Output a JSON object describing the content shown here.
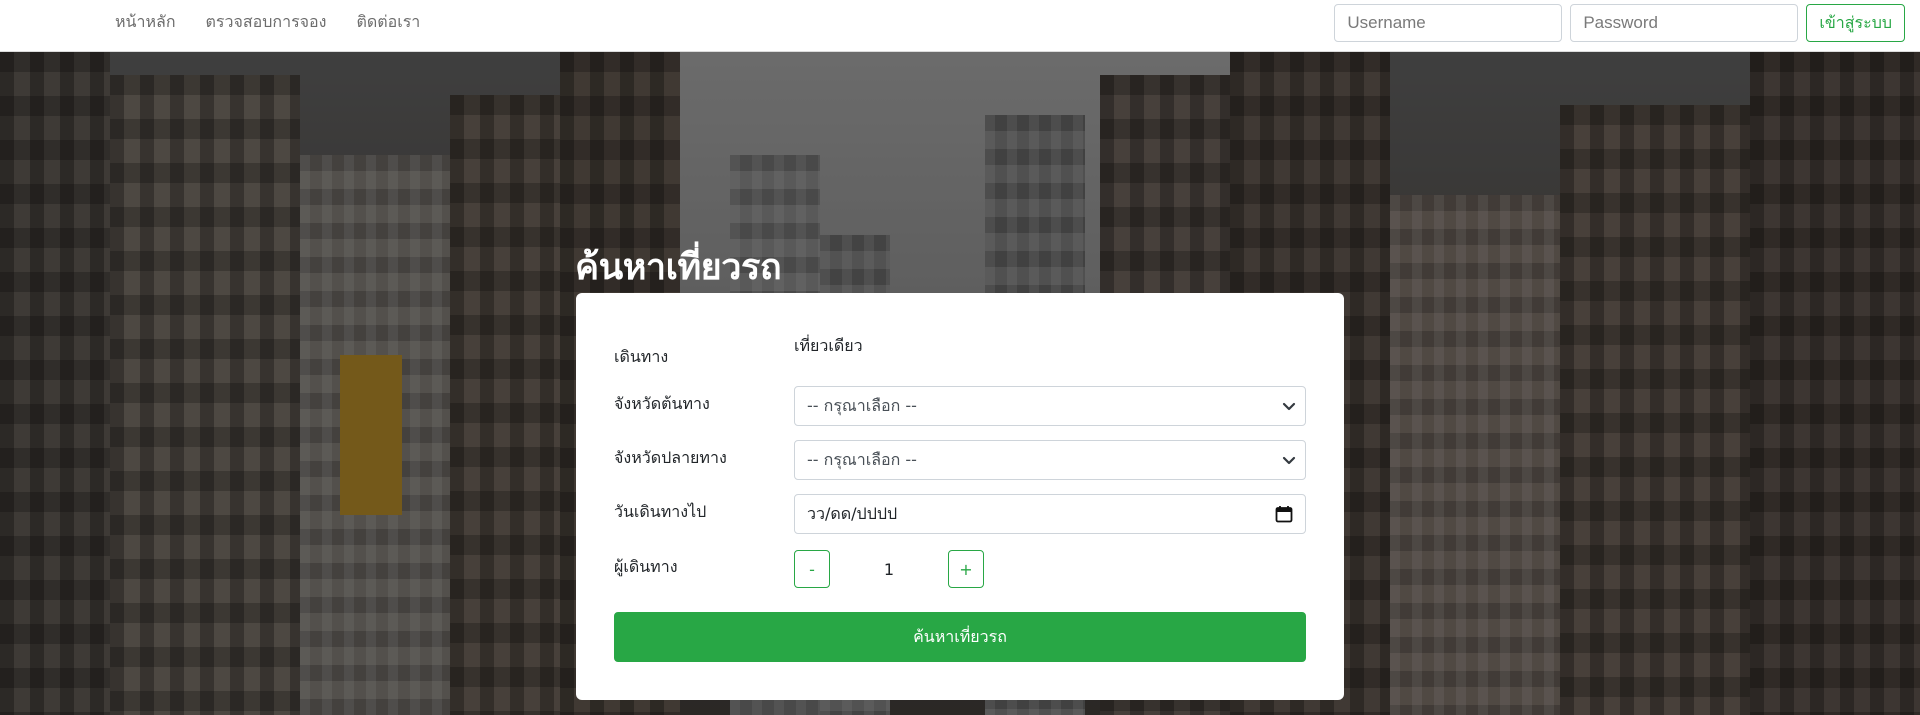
{
  "navbar": {
    "links": [
      "หน้าหลัก",
      "ตรวจสอบการจอง",
      "ติดต่อเรา"
    ],
    "username_placeholder": "Username",
    "password_placeholder": "Password",
    "login_label": "เข้าสู่ระบบ"
  },
  "search": {
    "title": "ค้นหาเที่ยวรถ",
    "trip_label": "เดินทาง",
    "trip_value": "เที่ยวเดียว",
    "origin_label": "จังหวัดต้นทาง",
    "origin_value": "-- กรุณาเลือก --",
    "destination_label": "จังหวัดปลายทาง",
    "destination_value": "-- กรุณาเลือก --",
    "date_label": "วันเดินทางไป",
    "date_value": "วว/ดด/ปปปป",
    "passengers_label": "ผู้เดินทาง",
    "minus_label": "-",
    "passenger_count": "1",
    "plus_label": "+",
    "submit_label": "ค้นหาเที่ยวรถ"
  },
  "colors": {
    "accent": "#28a745",
    "nav_text": "#6c6c6c"
  },
  "icons": {
    "select_arrow": "chevron-down-icon",
    "date_picker": "calendar-icon"
  }
}
